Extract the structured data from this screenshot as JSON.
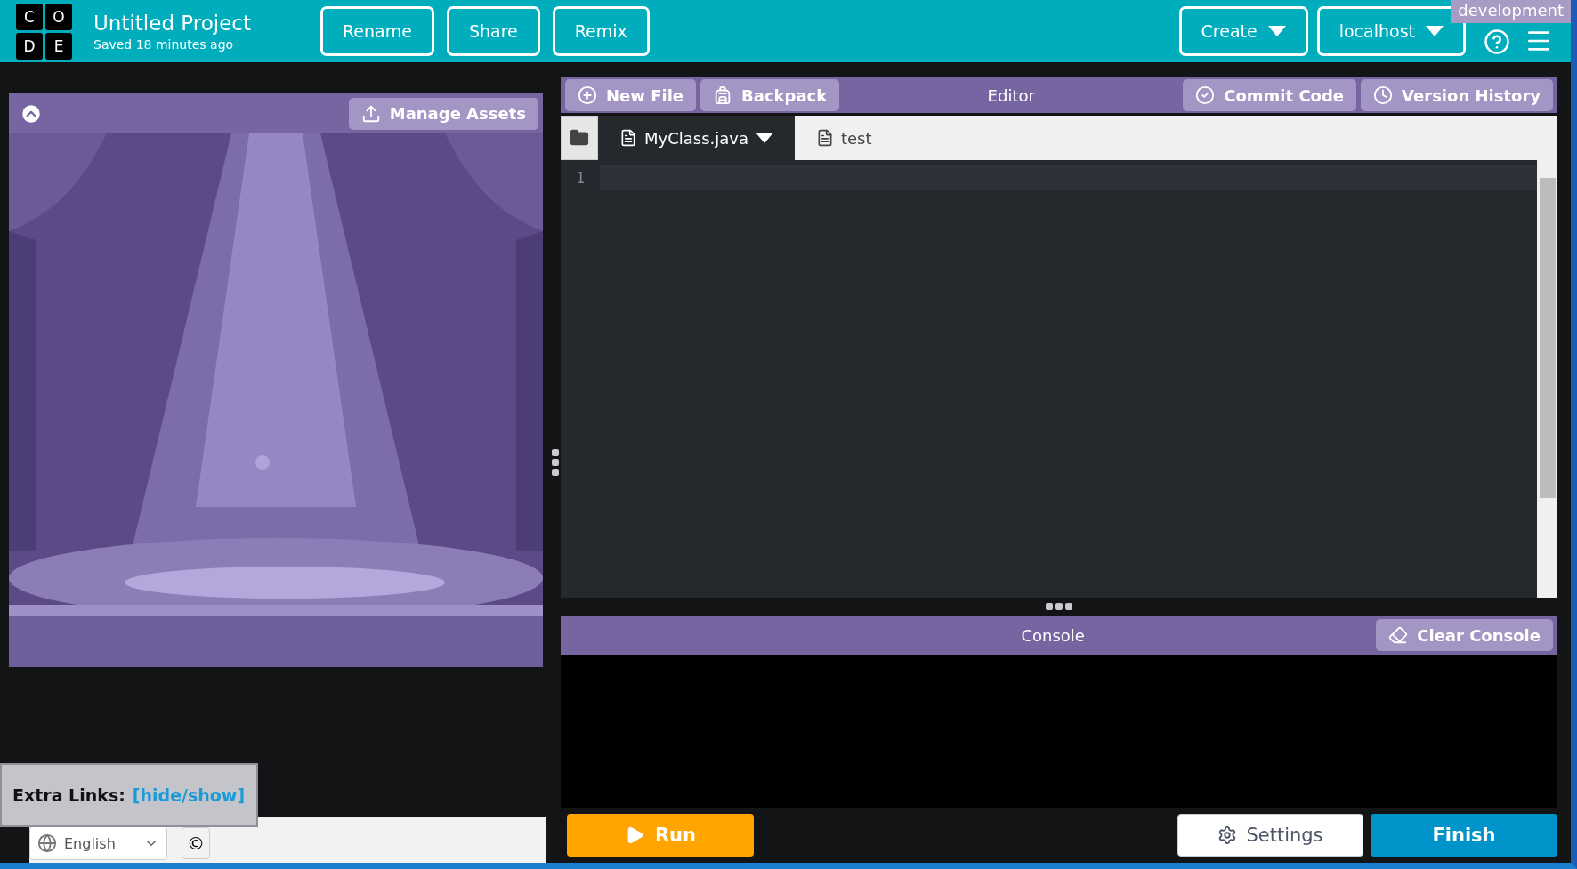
{
  "header": {
    "logo_letters": [
      "C",
      "O",
      "D",
      "E"
    ],
    "title": "Untitled Project",
    "subtitle": "Saved 18 minutes ago",
    "buttons": [
      "Rename",
      "Share",
      "Remix"
    ],
    "dropdowns": [
      "Create",
      "localhost"
    ],
    "env_badge": "development"
  },
  "left_panel": {
    "manage_assets": "Manage Assets"
  },
  "editor": {
    "title": "Editor",
    "buttons": [
      {
        "label": "New File",
        "kind": "new"
      },
      {
        "label": "Backpack",
        "kind": "backpack"
      },
      {
        "label": "Commit Code",
        "kind": "commit"
      },
      {
        "label": "Version History",
        "kind": "history"
      }
    ],
    "file_tabs": [
      {
        "label": "MyClass.java",
        "selected": true
      },
      {
        "label": "test",
        "selected": false
      }
    ],
    "line_numbers": [
      "1"
    ]
  },
  "console": {
    "title": "Console",
    "clear_button": "Clear Console"
  },
  "bottom": {
    "run": "Run",
    "settings": "Settings",
    "finish": "Finish"
  },
  "extra_links": {
    "label": "Extra Links:",
    "link": "[hide/show]"
  },
  "footer": {
    "language": "English",
    "copyright": "©"
  }
}
